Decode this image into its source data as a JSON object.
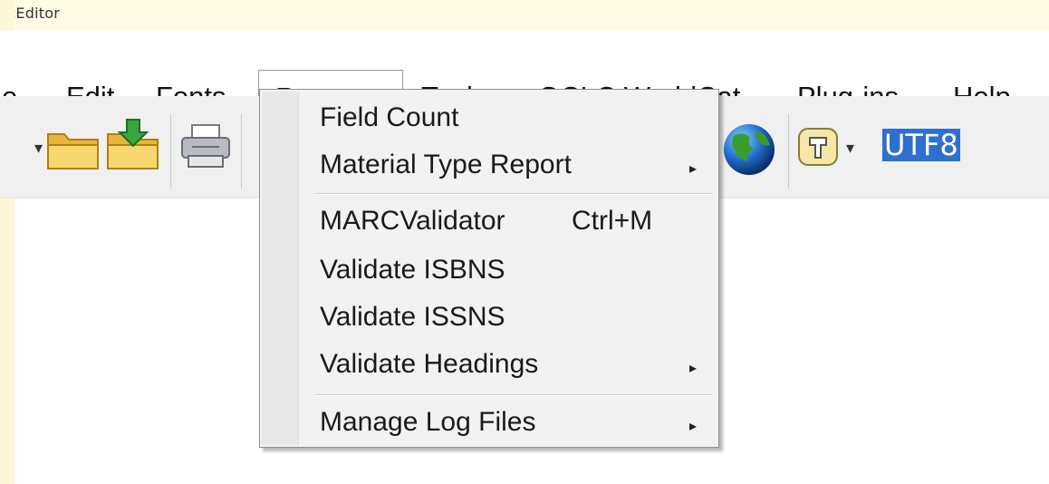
{
  "app": {
    "title": "rcEditor"
  },
  "menubar": {
    "items": [
      {
        "label": "e"
      },
      {
        "label": "Edit"
      },
      {
        "label": "Fonts"
      },
      {
        "label": "Reports"
      },
      {
        "label": "Tools"
      },
      {
        "label": "OCLC WorldCat"
      },
      {
        "label": "Plug-ins"
      },
      {
        "label": "Help"
      }
    ]
  },
  "toolbar": {
    "encoding_value": "UTF8",
    "icons": [
      "open-folder-icon",
      "download-folder-icon",
      "print-icon",
      "globe-icon",
      "tool-button-icon"
    ]
  },
  "reports_menu": {
    "items": [
      {
        "label": "Field Count"
      },
      {
        "label": "Material Type Report",
        "submenu": true
      },
      {
        "label": "MARCValidator",
        "shortcut": "Ctrl+M"
      },
      {
        "label": "Validate ISBNS"
      },
      {
        "label": "Validate ISSNS"
      },
      {
        "label": "Validate Headings",
        "submenu": true
      },
      {
        "label": "Manage Log Files",
        "submenu": true
      }
    ],
    "submenu_glyph": "▸"
  },
  "colors": {
    "highlight": "#2f6fcf",
    "titlebar": "#fffbe6",
    "toolbar": "#f0f0f0"
  }
}
